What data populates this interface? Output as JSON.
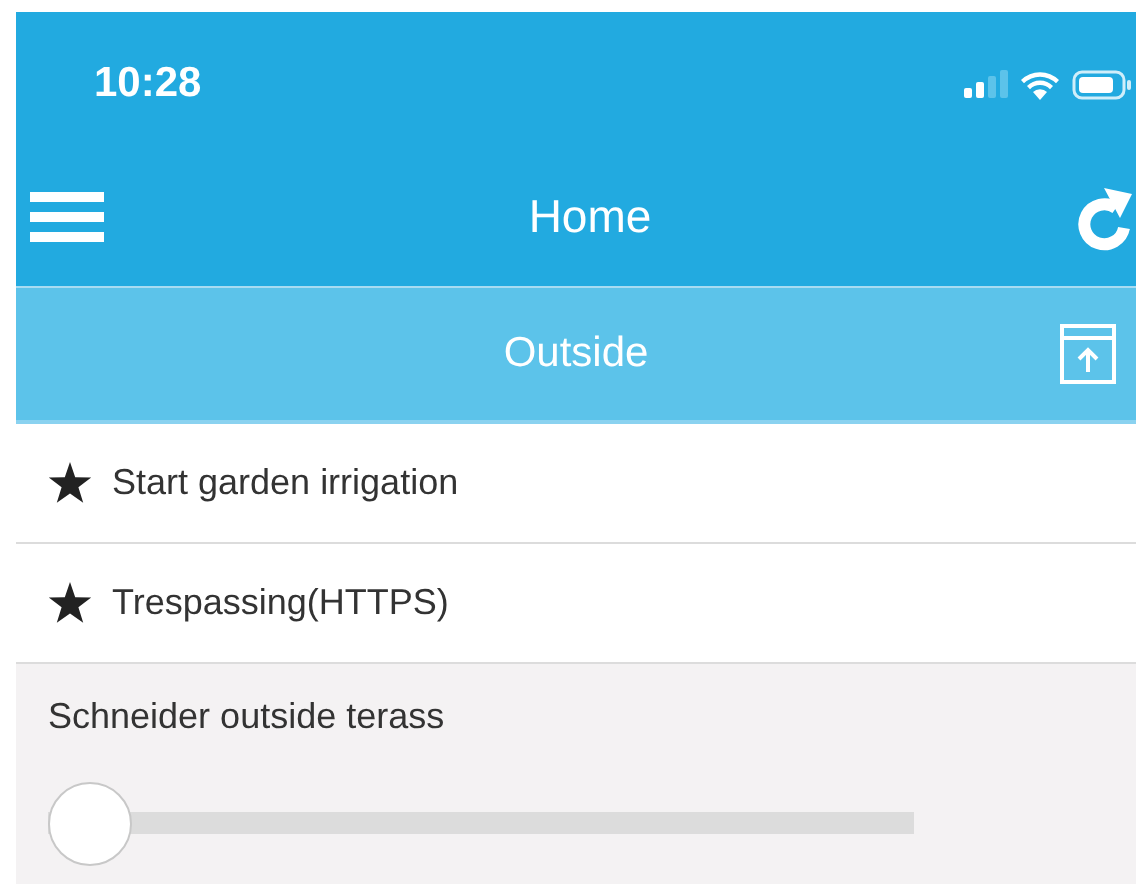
{
  "status_bar": {
    "time": "10:28"
  },
  "nav": {
    "title": "Home"
  },
  "section": {
    "title": "Outside"
  },
  "items": [
    {
      "kind": "scene",
      "label": "Start garden irrigation",
      "favorite": true
    },
    {
      "kind": "scene",
      "label": "Trespassing(HTTPS)",
      "favorite": true
    },
    {
      "kind": "slider",
      "label": "Schneider outside terass",
      "level": 0
    }
  ]
}
